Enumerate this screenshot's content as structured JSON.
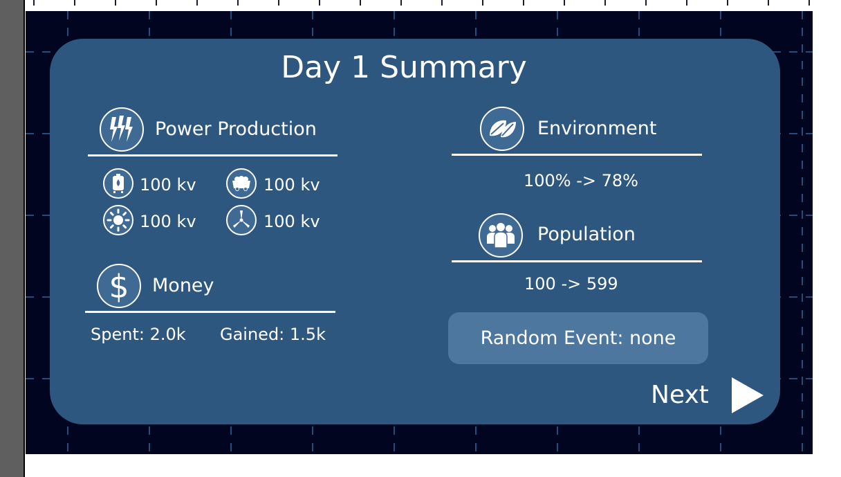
{
  "title": "Day 1 Summary",
  "power": {
    "label": "Power Production",
    "sources": [
      {
        "icon": "gas-tank-icon",
        "value": "100 kv"
      },
      {
        "icon": "coal-cart-icon",
        "value": "100 kv"
      },
      {
        "icon": "solar-icon",
        "value": "100 kv"
      },
      {
        "icon": "wind-turbine-icon",
        "value": "100 kv"
      }
    ]
  },
  "money": {
    "label": "Money",
    "spent": "Spent: 2.0k",
    "gained": "Gained: 1.5k"
  },
  "environment": {
    "label": "Environment",
    "change": "100% -> 78%"
  },
  "population": {
    "label": "Population",
    "change": "100 -> 599"
  },
  "event": {
    "text": "Random Event: none"
  },
  "next": {
    "label": "Next"
  },
  "colors": {
    "panel": "#2d577e",
    "background": "#010520",
    "grid": "#2b5a8a",
    "event_box": "#4d779e",
    "text": "#ffffff"
  }
}
